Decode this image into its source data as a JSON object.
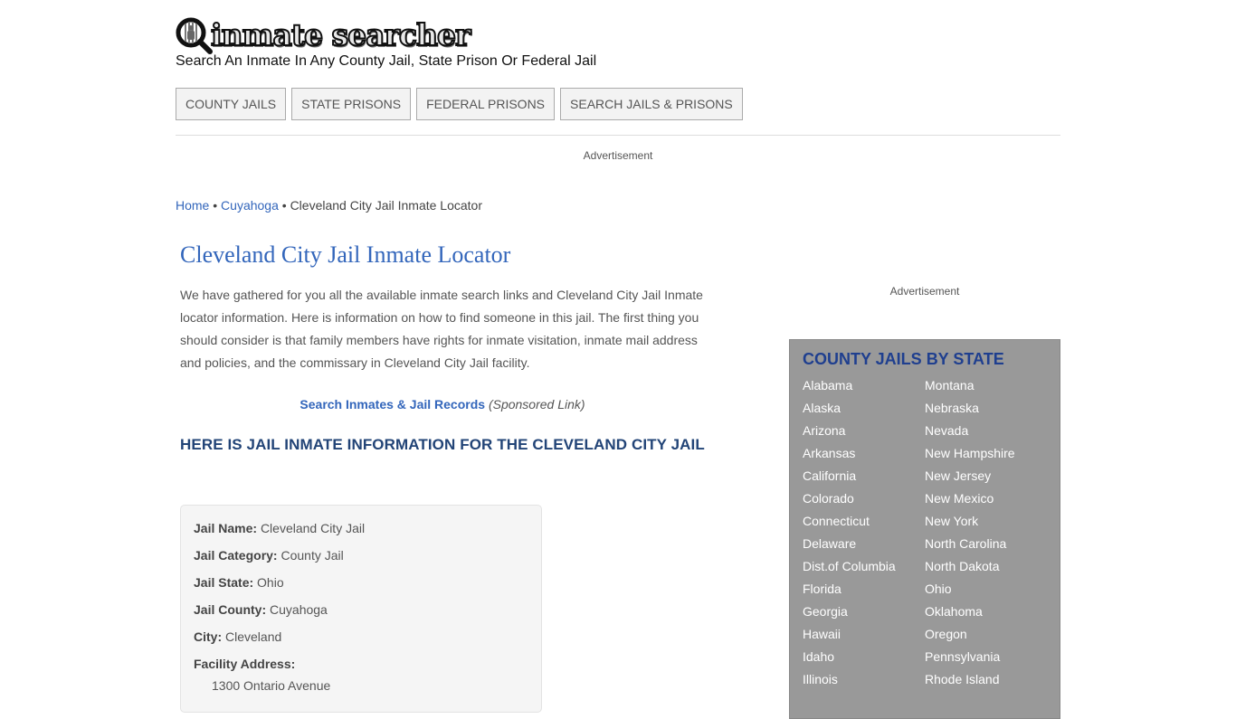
{
  "header": {
    "logo_text": "inmate searcher",
    "tagline": "Search An Inmate In Any County Jail, State Prison Or Federal Jail"
  },
  "nav": {
    "items": [
      {
        "label": "COUNTY JAILS"
      },
      {
        "label": "STATE PRISONS"
      },
      {
        "label": "FEDERAL PRISONS"
      },
      {
        "label": "SEARCH JAILS & PRISONS"
      }
    ]
  },
  "ads": {
    "top": "Advertisement",
    "side": "Advertisement"
  },
  "breadcrumb": {
    "home": "Home",
    "county": "Cuyahoga",
    "separator": "•",
    "current": "Cleveland City Jail Inmate Locator"
  },
  "main": {
    "title": "Cleveland City Jail Inmate Locator",
    "intro": "We have gathered for you all the available inmate search links and Cleveland City Jail Inmate locator information. Here is information on how to find someone in this jail. The first thing you should consider is that family members have rights for inmate visitation, inmate mail address and policies, and the commissary in Cleveland City Jail facility.",
    "sponsored_link": "Search Inmates & Jail Records",
    "sponsored_note": "(Sponsored Link)",
    "section_heading": "HERE IS JAIL INMATE INFORMATION FOR THE CLEVELAND CITY JAIL"
  },
  "info": {
    "fields": [
      {
        "label": "Jail Name:",
        "value": "Cleveland City Jail"
      },
      {
        "label": "Jail Category:",
        "value": "County Jail"
      },
      {
        "label": "Jail State:",
        "value": "Ohio"
      },
      {
        "label": "Jail County:",
        "value": "Cuyahoga"
      },
      {
        "label": "City:",
        "value": "Cleveland"
      }
    ],
    "address_label": "Facility Address:",
    "address_line1": "1300 Ontario Avenue"
  },
  "states": {
    "heading": "COUNTY JAILS BY STATE",
    "col1": [
      "Alabama",
      "Alaska",
      "Arizona",
      "Arkansas",
      "California",
      "Colorado",
      "Connecticut",
      "Delaware",
      "Dist.of Columbia",
      "Florida",
      "Georgia",
      "Hawaii",
      "Idaho",
      "Illinois"
    ],
    "col2": [
      "Montana",
      "Nebraska",
      "Nevada",
      "New Hampshire",
      "New Jersey",
      "New Mexico",
      "New York",
      "North Carolina",
      "North Dakota",
      "Ohio",
      "Oklahoma",
      "Oregon",
      "Pennsylvania",
      "Rhode Island"
    ]
  }
}
